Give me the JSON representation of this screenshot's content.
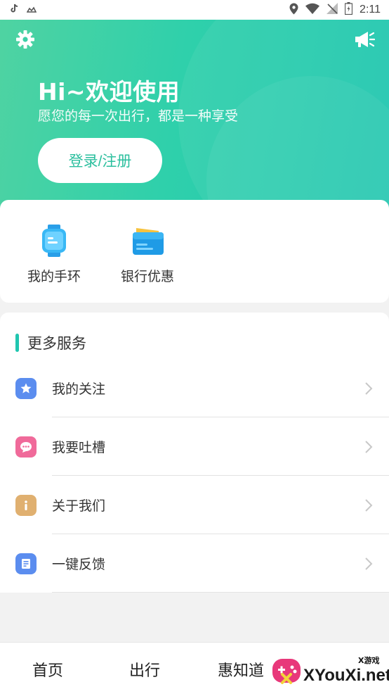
{
  "status_bar": {
    "time": "2:11",
    "icons": [
      "tiktok-icon",
      "app-icon",
      "location-icon",
      "wifi-icon",
      "no-signal-icon",
      "battery-icon"
    ]
  },
  "header": {
    "greeting": "Hi~欢迎使用",
    "subtitle": "愿您的每一次出行，都是一种享受",
    "login_button": "登录/注册",
    "gradient_start": "#4fd3a2",
    "gradient_end": "#20c6b0"
  },
  "quick_actions": [
    {
      "label": "我的手环",
      "icon": "smart-band-icon"
    },
    {
      "label": "银行优惠",
      "icon": "bank-card-icon"
    }
  ],
  "services": {
    "title": "更多服务",
    "accent": "#20c6b0",
    "items": [
      {
        "label": "我的关注",
        "icon": "star-icon",
        "color": "#5b8def"
      },
      {
        "label": "我要吐槽",
        "icon": "chat-bubble-icon",
        "color": "#f06a9a"
      },
      {
        "label": "关于我们",
        "icon": "info-icon",
        "color": "#e0b070"
      },
      {
        "label": "一键反馈",
        "icon": "feedback-document-icon",
        "color": "#5b8def"
      }
    ]
  },
  "bottom_nav": {
    "items": [
      "首页",
      "出行",
      "惠知道"
    ]
  },
  "watermark": {
    "text": "XYouXi.net",
    "small": "X游戏"
  }
}
